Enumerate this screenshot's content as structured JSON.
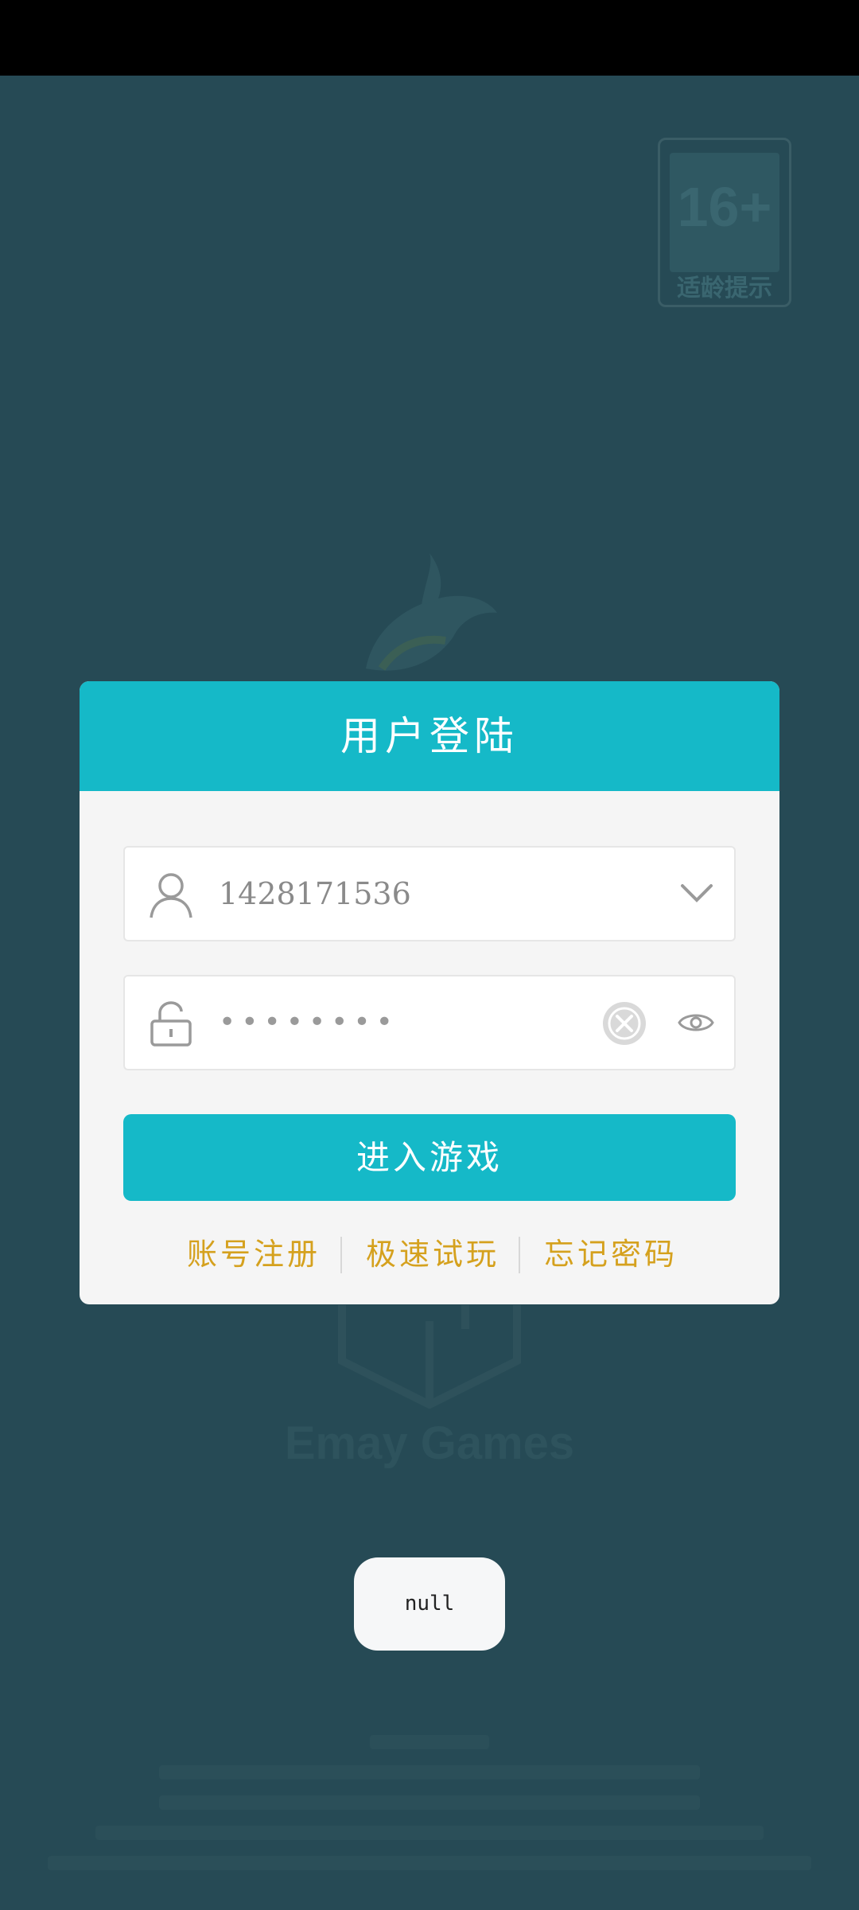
{
  "age_rating": {
    "number": "16+",
    "label": "适龄提示"
  },
  "background": {
    "brand": "Emay Games"
  },
  "login_dialog": {
    "title": "用户登陆",
    "username": {
      "value": "1428171536"
    },
    "password": {
      "masked_value": "••••••••"
    },
    "submit_label": "进入游戏",
    "links": {
      "register": "账号注册",
      "quick_play": "极速试玩",
      "forgot": "忘记密码"
    }
  },
  "toast": {
    "text": "null"
  },
  "colors": {
    "accent": "#15b9c8",
    "link": "#d5a11e",
    "background": "#264a55"
  }
}
